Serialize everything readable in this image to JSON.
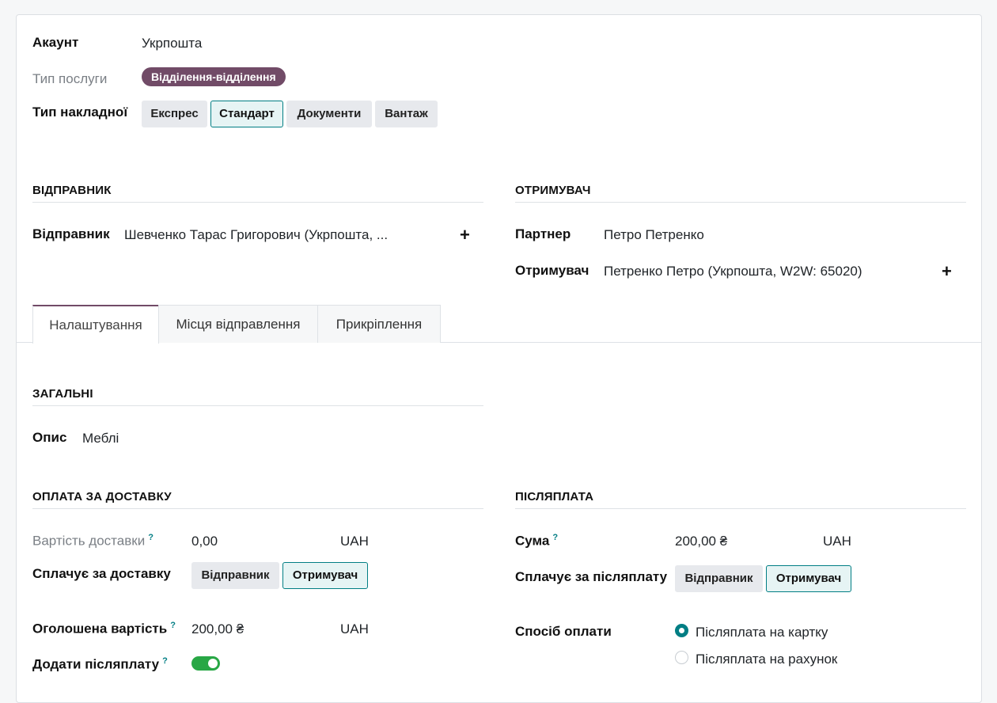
{
  "header": {
    "account_label": "Акаунт",
    "account_value": "Укрпошта",
    "service_type_label": "Тип послуги",
    "service_type_badge": "Відділення-відділення",
    "waybill_type_label": "Тип накладної",
    "waybill_types": [
      "Експрес",
      "Стандарт",
      "Документи",
      "Вантаж"
    ],
    "waybill_type_selected": "Стандарт"
  },
  "sender_section": {
    "title": "ВІДПРАВНИК",
    "sender_label": "Відправник",
    "sender_value": "Шевченко Тарас Григорович (Укрпошта, ...",
    "add_icon": "plus-icon"
  },
  "recipient_section": {
    "title": "ОТРИМУВАЧ",
    "partner_label": "Партнер",
    "partner_value": "Петро Петренко",
    "recipient_label": "Отримувач",
    "recipient_value": "Петренко Петро (Укрпошта, W2W: 65020)",
    "add_icon": "plus-icon"
  },
  "tabs": [
    {
      "label": "Налаштування",
      "active": true
    },
    {
      "label": "Місця відправлення",
      "active": false
    },
    {
      "label": "Прикріплення",
      "active": false
    }
  ],
  "general": {
    "title": "ЗАГАЛЬНІ",
    "description_label": "Опис",
    "description_value": "Меблі"
  },
  "delivery_payment": {
    "title": "ОПЛАТА ЗА ДОСТАВКУ",
    "cost_label": "Вартість доставки",
    "cost_value": "0,00",
    "cost_currency": "UAH",
    "payer_label": "Сплачує за доставку",
    "payer_options": [
      "Відправник",
      "Отримувач"
    ],
    "payer_selected": "Отримувач",
    "declared_label": "Оголошена вартість",
    "declared_value": "200,00 ₴",
    "declared_currency": "UAH",
    "add_cod_label": "Додати післяплату",
    "add_cod_enabled": true,
    "help_mark": "?"
  },
  "cod": {
    "title": "ПІСЛЯПЛАТА",
    "amount_label": "Сума",
    "amount_value": "200,00 ₴",
    "amount_currency": "UAH",
    "payer_label": "Сплачує за післяплату",
    "payer_options": [
      "Відправник",
      "Отримувач"
    ],
    "payer_selected": "Отримувач",
    "method_label": "Спосіб оплати",
    "methods": [
      "Післяплата на картку",
      "Післяплата на рахунок"
    ],
    "method_selected": "Післяплата на картку",
    "help_mark": "?"
  },
  "colors": {
    "badge": "#714b67",
    "accent": "#017e84",
    "toggle_on": "#28a745"
  }
}
